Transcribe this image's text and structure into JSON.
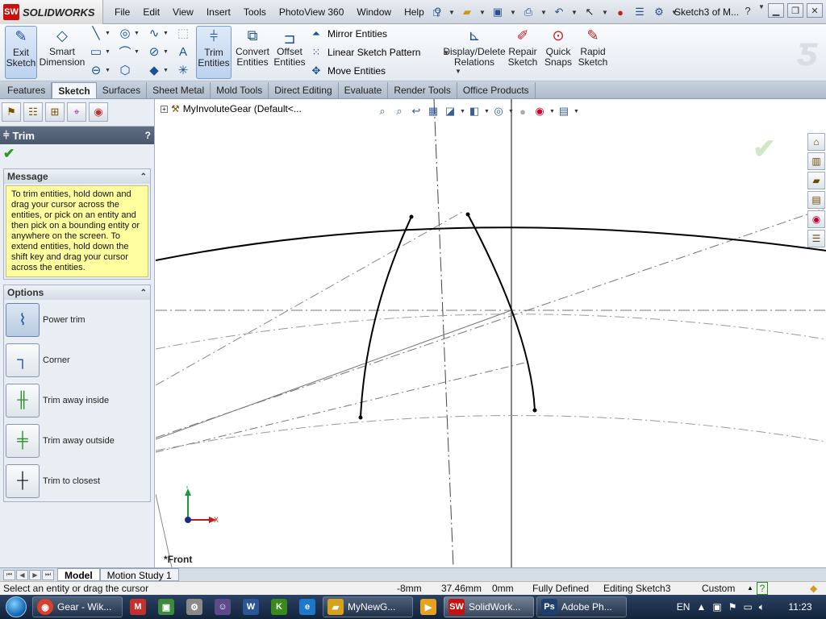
{
  "app": {
    "logo_text": "SOLIDWORKS",
    "logo_mark": "SW",
    "doc_title": "Sketch3 of M..."
  },
  "menu": [
    "File",
    "Edit",
    "View",
    "Insert",
    "Tools",
    "PhotoView 360",
    "Window",
    "Help"
  ],
  "ribbon": {
    "exit_sketch": "Exit Sketch",
    "smart_dimension": "Smart Dimension",
    "trim_entities": "Trim Entities",
    "convert_entities": "Convert Entities",
    "offset_entities": "Offset Entities",
    "mirror_entities": "Mirror Entities",
    "linear_pattern": "Linear Sketch Pattern",
    "move_entities": "Move Entities",
    "display_delete_relations": "Display/Delete Relations",
    "repair_sketch": "Repair Sketch",
    "quick_snaps": "Quick Snaps",
    "rapid_sketch": "Rapid Sketch"
  },
  "tabs": [
    "Features",
    "Sketch",
    "Surfaces",
    "Sheet Metal",
    "Mold Tools",
    "Direct Editing",
    "Evaluate",
    "Render Tools",
    "Office Products"
  ],
  "active_tab": "Sketch",
  "property_manager": {
    "title": "Trim",
    "help": "?",
    "message_header": "Message",
    "message": "To trim entities, hold down and drag your cursor across the entities, or pick on an entity and then pick on a bounding entity or anywhere on the screen.  To extend entities, hold down the shift key and drag your cursor across the entities.",
    "options_header": "Options",
    "options": [
      {
        "label": "Power trim",
        "selected": true,
        "icon": "power-trim-icon"
      },
      {
        "label": "Corner",
        "selected": false,
        "icon": "corner-icon"
      },
      {
        "label": "Trim away inside",
        "selected": false,
        "icon": "trim-away-inside-icon"
      },
      {
        "label": "Trim away outside",
        "selected": false,
        "icon": "trim-away-outside-icon"
      },
      {
        "label": "Trim to closest",
        "selected": false,
        "icon": "trim-to-closest-icon"
      }
    ]
  },
  "canvas": {
    "tree_root": "MyInvoluteGear  (Default<...",
    "view_label": "*Front",
    "axis_x": "X",
    "axis_y": "Y"
  },
  "bottom_tabs": [
    "Model",
    "Motion Study 1"
  ],
  "status": {
    "prompt": "Select an entity or drag the cursor",
    "x": "-8mm",
    "y": "37.46mm",
    "z": "0mm",
    "state": "Fully Defined",
    "editing": "Editing Sketch3",
    "units": "Custom",
    "help": "?"
  },
  "taskbar": {
    "items": [
      {
        "label": "Gear - Wik...",
        "icon": "chrome-icon",
        "color": "#d9412c"
      },
      {
        "label": "",
        "icon": "gmail-icon",
        "color": "#c4302b"
      },
      {
        "label": "",
        "icon": "app-icon",
        "color": "#3d8a3d"
      },
      {
        "label": "",
        "icon": "app-icon",
        "color": "#8a8a8a"
      },
      {
        "label": "",
        "icon": "app-icon",
        "color": "#5c4a8a"
      },
      {
        "label": "",
        "icon": "word-icon",
        "color": "#2b5797"
      },
      {
        "label": "",
        "icon": "app-icon",
        "color": "#3a8a1a"
      },
      {
        "label": "",
        "icon": "ie-icon",
        "color": "#1c78c8"
      },
      {
        "label": "MyNewG...",
        "icon": "folder-icon",
        "color": "#d6a21e"
      },
      {
        "label": "",
        "icon": "media-icon",
        "color": "#e6a11e"
      },
      {
        "label": "SolidWork...",
        "icon": "solidworks-icon",
        "color": "#c41313"
      },
      {
        "label": "Adobe Ph...",
        "icon": "photoshop-icon",
        "color": "#1d3f6e"
      }
    ],
    "language": "EN",
    "time": "11:23"
  }
}
